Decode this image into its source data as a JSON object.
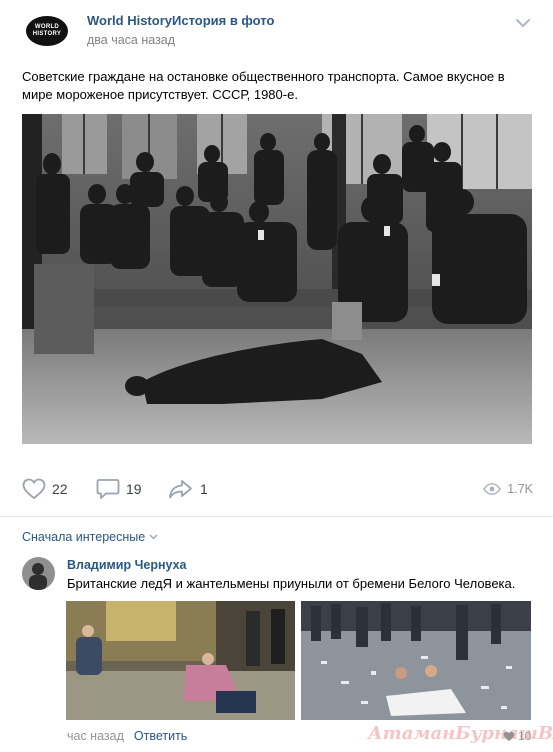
{
  "post": {
    "group_name": "World HistoryИстория в фото",
    "logo_text_line1": "WORLD",
    "logo_text_line2": "HISTORY",
    "time": "два часа назад",
    "text": "Советские граждане на остановке общественного транспорта. Самое вкусное в мире мороженое присутствует. СССР, 1980-е.",
    "photo_icon": "black-and-white-photo-soviet-bus-stop"
  },
  "actions": {
    "likes": "22",
    "comments": "19",
    "shares": "1",
    "views": "1.7K"
  },
  "comments": {
    "sort_label": "Сначала интересные",
    "items": [
      {
        "author": "Владимир Чернуха",
        "text": "Британские ледЯ и жантельмены приуныли от бремени Белого Человека.",
        "time": "час назад",
        "reply_label": "Ответить",
        "likes": "10"
      }
    ]
  },
  "watermark": "АтаманБурнашBARIN",
  "colors": {
    "link": "#2a5885",
    "muted": "#939393",
    "divider": "#e7e8ec"
  }
}
